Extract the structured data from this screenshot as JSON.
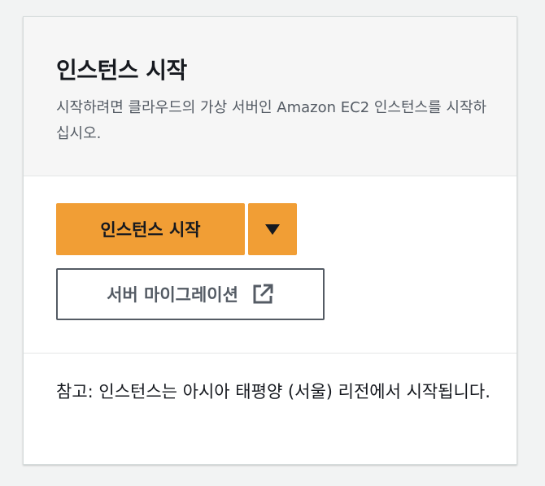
{
  "card": {
    "title": "인스턴스 시작",
    "subtitle": "시작하려면 클라우드의 가상 서버인 Amazon EC2 인스턴스를 시작하십시오."
  },
  "actions": {
    "launch_label": "인스턴스 시작",
    "dropdown_icon": "caret-down-icon",
    "migrate_label": "서버 마이그레이션",
    "migrate_icon": "external-link-icon"
  },
  "note": {
    "text": "참고: 인스턴스는 아시아 태평양 (서울) 리전에서 시작됩니다."
  },
  "colors": {
    "primary": "#f19e35",
    "text": "#16191f",
    "secondary_text": "#545b64",
    "header_bg": "#f6f6f6"
  }
}
